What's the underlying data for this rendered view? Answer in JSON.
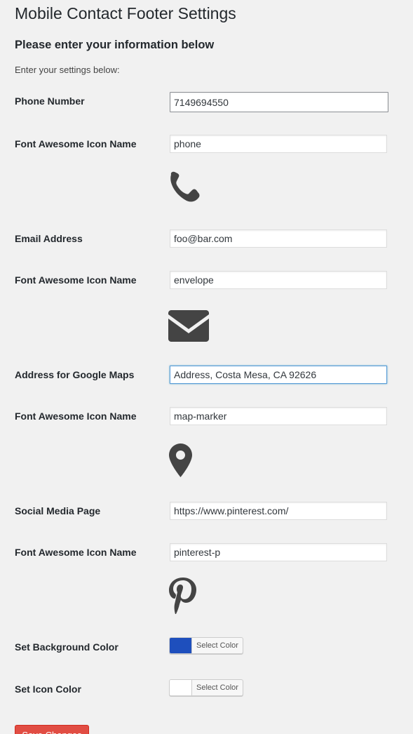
{
  "page": {
    "title": "Mobile Contact Footer Settings",
    "section_title": "Please enter your information below",
    "intro": "Enter your settings below:"
  },
  "fields": {
    "phone_label": "Phone Number",
    "phone_value": "7149694550",
    "phone_icon_label": "Font Awesome Icon Name",
    "phone_icon_value": "phone",
    "email_label": "Email Address",
    "email_value": "foo@bar.com",
    "email_icon_label": "Font Awesome Icon Name",
    "email_icon_value": "envelope",
    "address_label": "Address for Google Maps",
    "address_value": "Address, Costa Mesa, CA 92626",
    "address_icon_label": "Font Awesome Icon Name",
    "address_icon_value": "map-marker",
    "social_label": "Social Media Page",
    "social_value": "https://www.pinterest.com/",
    "social_icon_label": "Font Awesome Icon Name",
    "social_icon_value": "pinterest-p"
  },
  "colors": {
    "bg_label": "Set Background Color",
    "bg_button": "Select Color",
    "bg_value": "#1e4fbd",
    "icon_label": "Set Icon Color",
    "icon_button": "Select Color",
    "icon_value": "#ffffff"
  },
  "icons": {
    "phone": "phone-icon",
    "email": "envelope-icon",
    "address": "map-marker-icon",
    "social": "pinterest-p-icon"
  },
  "actions": {
    "save_label": "Save Changes"
  }
}
